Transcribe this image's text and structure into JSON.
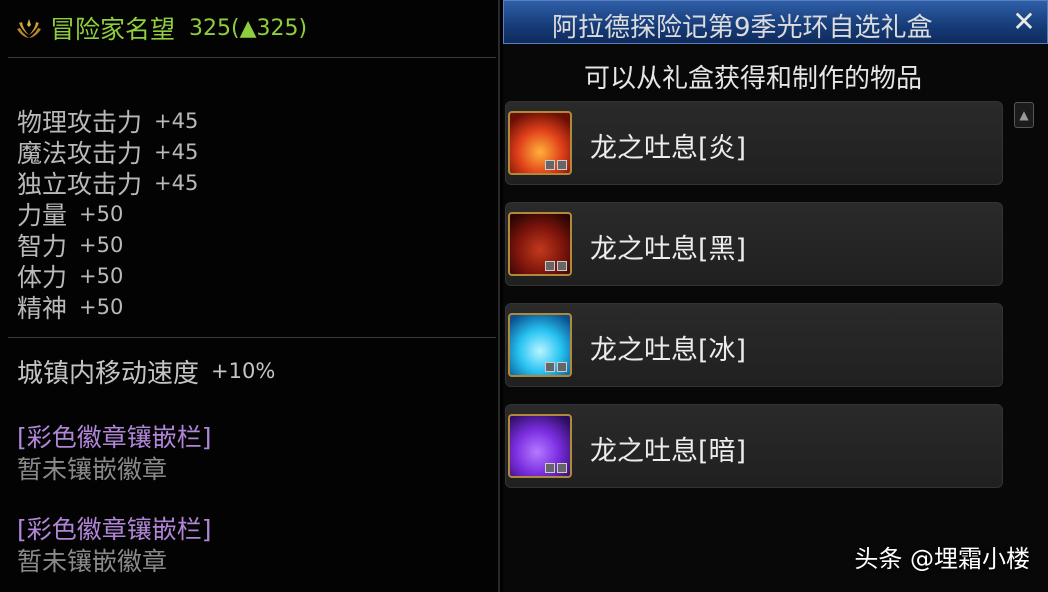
{
  "tooltip": {
    "reputation_label": "冒险家名望",
    "reputation_value": "325(▲325)",
    "stats": [
      {
        "name": "物理攻击力",
        "value": "+45"
      },
      {
        "name": "魔法攻击力",
        "value": "+45"
      },
      {
        "name": "独立攻击力",
        "value": "+45"
      },
      {
        "name": "力量",
        "value": "+50"
      },
      {
        "name": "智力",
        "value": "+50"
      },
      {
        "name": "体力",
        "value": "+50"
      },
      {
        "name": "精神",
        "value": "+50"
      }
    ],
    "move_speed": {
      "name": "城镇内移动速度",
      "value": "+10%"
    },
    "slots": [
      {
        "title": "[彩色徽章镶嵌栏]",
        "status": "暂未镶嵌徽章"
      },
      {
        "title": "[彩色徽章镶嵌栏]",
        "status": "暂未镶嵌徽章"
      }
    ],
    "colors": {
      "reputation": "#8fce3c",
      "slot_title": "#b186d8"
    }
  },
  "giftbox": {
    "title": "阿拉德探险记第9季光环自选礼盒",
    "close_label": "✕",
    "subtitle": "可以从礼盒获得和制作的物品",
    "items": [
      {
        "name": "龙之吐息[炎]",
        "color": "#e0401a"
      },
      {
        "name": "龙之吐息[黑]",
        "color": "#9a1e10"
      },
      {
        "name": "龙之吐息[冰]",
        "color": "#27c3f2"
      },
      {
        "name": "龙之吐息[暗]",
        "color": "#7a2ee0"
      }
    ],
    "scroll_up_icon": "▲"
  },
  "watermark": "头条 @埋霜小楼"
}
